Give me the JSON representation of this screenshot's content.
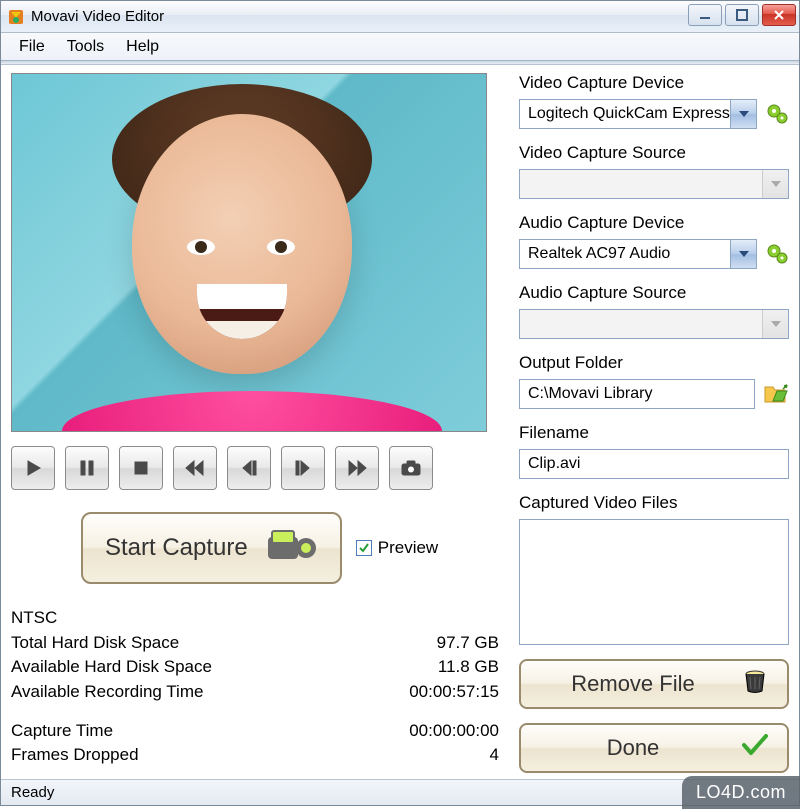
{
  "window": {
    "title": "Movavi Video Editor"
  },
  "menu": {
    "file": "File",
    "tools": "Tools",
    "help": "Help"
  },
  "captureButton": "Start Capture",
  "previewCheckbox": {
    "label": "Preview",
    "checked": true
  },
  "videoDevice": {
    "label": "Video Capture Device",
    "value": "Logitech QuickCam Express"
  },
  "videoSource": {
    "label": "Video Capture Source",
    "value": ""
  },
  "audioDevice": {
    "label": "Audio Capture Device",
    "value": "Realtek AC97 Audio"
  },
  "audioSource": {
    "label": "Audio Capture Source",
    "value": ""
  },
  "outputFolder": {
    "label": "Output Folder",
    "value": "C:\\Movavi Library"
  },
  "filename": {
    "label": "Filename",
    "value": "Clip.avi"
  },
  "capturedFiles": {
    "label": "Captured Video Files"
  },
  "buttons": {
    "removeFile": "Remove File",
    "done": "Done"
  },
  "stats": {
    "standard": "NTSC",
    "totalLabel": "Total Hard Disk Space",
    "totalValue": "97.7 GB",
    "availLabel": "Available Hard Disk Space",
    "availValue": "11.8 GB",
    "recTimeLabel": "Available Recording Time",
    "recTimeValue": "00:00:57:15",
    "capTimeLabel": "Capture Time",
    "capTimeValue": "00:00:00:00",
    "droppedLabel": "Frames Dropped",
    "droppedValue": "4"
  },
  "status": "Ready",
  "watermark": "LO4D.com"
}
